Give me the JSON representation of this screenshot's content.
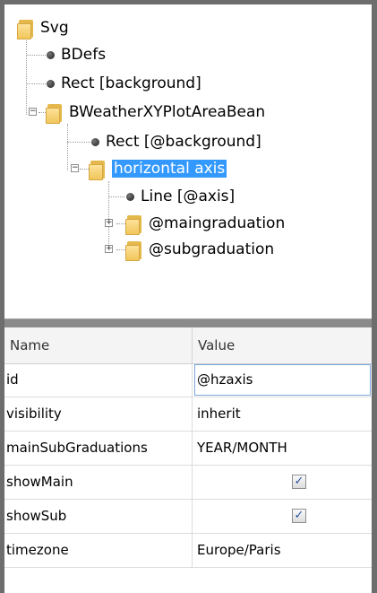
{
  "tree": {
    "nodes": [
      {
        "label": "Svg",
        "icon": "folder-icon",
        "state": "expanded"
      },
      {
        "label": "BDefs",
        "icon": "bullet-icon"
      },
      {
        "label": "Rect [background]",
        "icon": "bullet-icon"
      },
      {
        "label": "BWeatherXYPlotAreaBean",
        "icon": "folder-icon",
        "state": "expanded"
      },
      {
        "label": "Rect [@background]",
        "icon": "bullet-icon"
      },
      {
        "label": "horizontal axis",
        "icon": "folder-icon",
        "state": "expanded",
        "selected": true
      },
      {
        "label": "Line [@axis]",
        "icon": "bullet-icon"
      },
      {
        "label": "@maingraduation",
        "icon": "folder-icon",
        "state": "collapsed"
      },
      {
        "label": "@subgraduation",
        "icon": "folder-icon",
        "state": "collapsed"
      }
    ]
  },
  "props": {
    "header": {
      "name": "Name",
      "value": "Value"
    },
    "rows": [
      {
        "name": "id",
        "value": "@hzaxis"
      },
      {
        "name": "visibility",
        "value": "inherit"
      },
      {
        "name": "mainSubGraduations",
        "value": "YEAR/MONTH"
      },
      {
        "name": "showMain",
        "value": "",
        "checked": true
      },
      {
        "name": "showSub",
        "value": "",
        "checked": true
      },
      {
        "name": "timezone",
        "value": "Europe/Paris"
      }
    ]
  },
  "colors": {
    "selection": "#3399ff",
    "folder": "#f1c65a",
    "frame": "#6d6d6d"
  }
}
